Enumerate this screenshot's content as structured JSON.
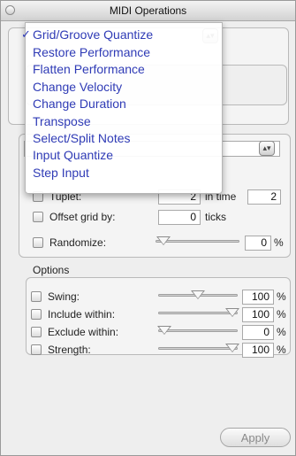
{
  "window": {
    "title": "MIDI Operations"
  },
  "menu": {
    "items": [
      {
        "label": "Grid/Groove Quantize",
        "checked": true
      },
      {
        "label": "Restore Performance"
      },
      {
        "label": "Flatten Performance"
      },
      {
        "label": "Change Velocity"
      },
      {
        "label": "Change Duration"
      },
      {
        "label": "Transpose"
      },
      {
        "label": "Select/Split Notes"
      },
      {
        "label": "Input Quantize"
      },
      {
        "label": "Step Input"
      }
    ],
    "check_mark": "✓"
  },
  "quantize": {
    "tuplet": {
      "label": "Tuplet:",
      "value": "2",
      "suffix": "in time",
      "time_value": "2"
    },
    "offset": {
      "label": "Offset grid by:",
      "value": "0",
      "unit": "ticks"
    },
    "randomize": {
      "label": "Randomize:",
      "value": "0",
      "unit": "%",
      "level": 0
    }
  },
  "options": {
    "title": "Options",
    "rows": [
      {
        "label": "Swing:",
        "value": "100",
        "unit": "%",
        "level": 0.5
      },
      {
        "label": "Include within:",
        "value": "100",
        "unit": "%",
        "level": 1.0
      },
      {
        "label": "Exclude within:",
        "value": "0",
        "unit": "%",
        "level": 0
      },
      {
        "label": "Strength:",
        "value": "100",
        "unit": "%",
        "level": 1.0
      }
    ]
  },
  "apply_label": "Apply",
  "icons": {
    "popup": "up-down-arrows-icon",
    "close": "close-dot-icon"
  }
}
